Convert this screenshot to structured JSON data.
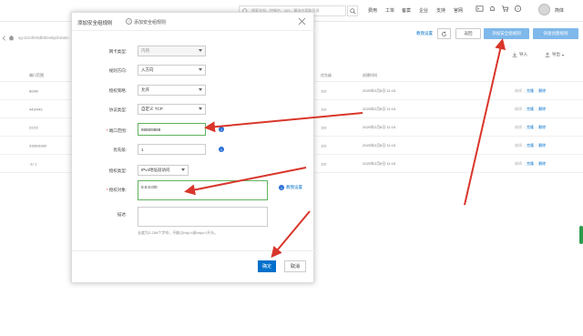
{
  "topbar": {
    "search_placeholder": "搜索文档、控制台、API、解决方案和资源",
    "nav": [
      "费用",
      "工单",
      "备案",
      "企业",
      "支持",
      "官网"
    ],
    "user": "简体"
  },
  "subbar": {
    "breadcrumb": "sg-2ze3hr9dbt9ze8pzbm6m",
    "link": "教我设置",
    "back_label": "返回",
    "add_rule_label": "添加安全组规则",
    "quick_rule_label": "快速创建规则",
    "import_label": "导入",
    "export_label": "导出"
  },
  "table": {
    "header_port": "端口范围",
    "header_priority": "优先级",
    "header_time": "创建时间",
    "rows": [
      {
        "port": "80/80",
        "priority": "110",
        "time": "2020年2月8日 11:15"
      },
      {
        "port": "443/443",
        "priority": "110",
        "time": "2020年2月8日 11:15"
      },
      {
        "port": "22/22",
        "priority": "110",
        "time": "2020年2月8日 11:15"
      },
      {
        "port": "3389/3389",
        "priority": "110",
        "time": "2020年2月8日 11:15"
      },
      {
        "port": "-1/-1",
        "priority": "110",
        "time": "2020年2月8日 11:15"
      }
    ],
    "op_edit": "编辑",
    "op_clone": "克隆",
    "op_delete": "删除"
  },
  "modal": {
    "title": "添加安全组规则",
    "help_label": "添加安全组规则",
    "fields": {
      "nic_label": "网卡类型:",
      "nic_value": "内网",
      "direction_label": "规则方向:",
      "direction_value": "入方向",
      "policy_label": "授权策略:",
      "policy_value": "允许",
      "protocol_label": "协议类型:",
      "protocol_value": "自定义 TCP",
      "port_label": "端口范围:",
      "port_value": "8888/8888",
      "priority_label": "优先级:",
      "priority_value": "1",
      "auth_type_label": "授权类型:",
      "auth_type_value": "IPv4地址段访问",
      "auth_obj_label": "授权对象:",
      "auth_obj_value": "0.0.0.0/0",
      "auth_obj_link": "教我设置",
      "desc_label": "描述:",
      "desc_tip": "长度为2-256个字符，不能以http://或https://开头。"
    },
    "ok_label": "确定",
    "cancel_label": "取消"
  },
  "colors": {
    "accent": "#0070cc",
    "primary_btn": "#0070cc",
    "sub_btn_light": "#7fb8ea",
    "highlight_border": "#5fb35f",
    "arrow": "#d9362b"
  }
}
